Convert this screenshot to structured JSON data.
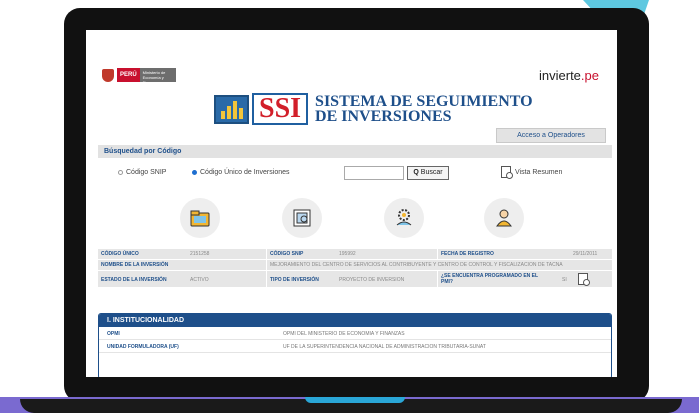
{
  "header": {
    "peru_label": "PERÚ",
    "ministry_label": "Ministerio de Economía y Finanzas",
    "invierte_prefix": "invierte",
    "invierte_suffix": ".pe",
    "ssi_logo_text": "SSI",
    "system_title_line1": "SISTEMA DE SEGUIMIENTO",
    "system_title_line2": "DE INVERSIONES"
  },
  "acceso_button": "Acceso a Operadores",
  "search": {
    "section_title": "Búsquedad por Código",
    "option_snip": "Código SNIP",
    "option_cui": "Código Único de Inversiones",
    "selected": "Código Único de Inversiones",
    "input_value": "",
    "button_label": "Buscar",
    "vista_label": "Vista Resumen"
  },
  "icons": [
    "folder-icon",
    "document-icon",
    "gears-icon",
    "user-icon"
  ],
  "project": {
    "codigo_unico_label": "CÓDIGO ÚNICO",
    "codigo_unico_value": "2151258",
    "codigo_snip_label": "CÓDIGO SNIP",
    "codigo_snip_value": "195992",
    "fecha_label": "FECHA DE REGISTRO",
    "fecha_value": "29/11/2011",
    "nombre_label": "NOMBRE DE LA INVERSIÓN",
    "nombre_value": "MEJORAMIENTO DEL CENTRO DE SERVICIOS AL CONTRIBUYENTE Y CENTRO DE CONTROL Y FISCALIZACION DE TACNA",
    "estado_label": "ESTADO DE LA INVERSIÓN",
    "estado_value": "ACTIVO",
    "tipo_label": "TIPO DE INVERSIÓN",
    "tipo_value": "PROYECTO DE INVERSION",
    "pmi_label": "¿SE ENCUENTRA PROGRAMADO EN EL PMI?",
    "pmi_value": "SI"
  },
  "institucionalidad": {
    "title": "I. INSTITUCIONALIDAD",
    "rows": [
      {
        "label": "OPMI",
        "value": "OPMI DEL MINISTERIO DE ECONOMIA Y FINANZAS"
      },
      {
        "label": "UNIDAD FORMULADORA (UF)",
        "value": "UF DE LA SUPERINTENDENCIA NACIONAL DE ADMINISTRACION TRIBUTARIA-SUNAT"
      }
    ]
  },
  "colors": {
    "brand_blue": "#1e4f8a",
    "brand_red": "#d21f2a",
    "accent_cyan": "#5ec8e0",
    "base_purple": "#7a6ad0"
  }
}
